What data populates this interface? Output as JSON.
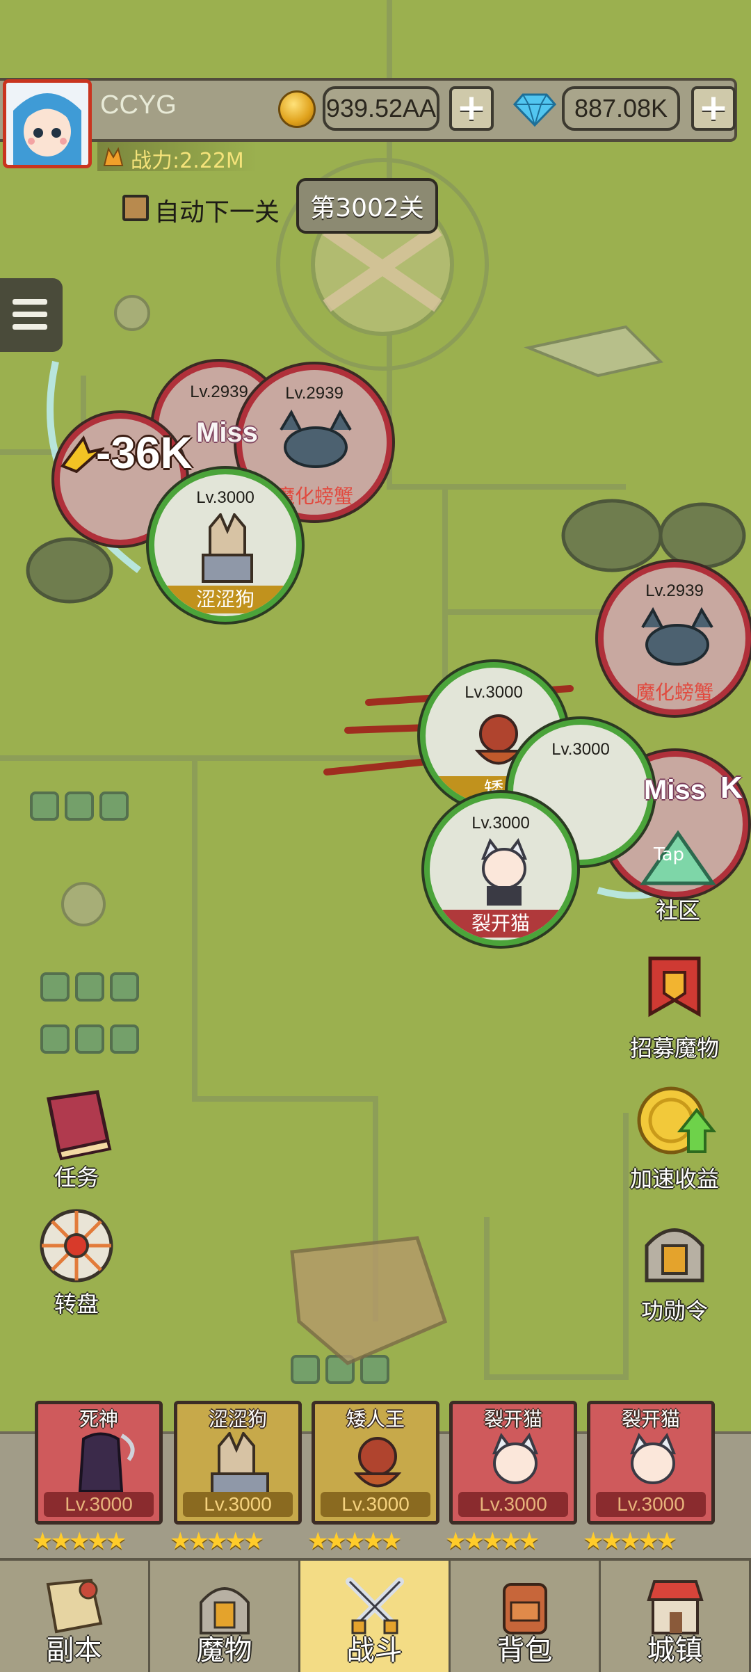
{
  "player": {
    "name": "CCYG",
    "power": "战力:2.22M"
  },
  "resources": {
    "gold": "939.52AA",
    "gems": "887.08K",
    "plus": "+"
  },
  "stage": {
    "auto_next_label": "自动下一关",
    "stage_label": "第3002关"
  },
  "battle": {
    "enemies": [
      {
        "lv": "Lv.2939",
        "name": ""
      },
      {
        "lv": "Lv.2939",
        "name": "魔化螃蟹"
      },
      {
        "lv": "Lv.2939",
        "name": "魔化螃蟹"
      },
      {
        "lv": "Lv.2939",
        "name": ""
      }
    ],
    "allies": [
      {
        "lv": "Lv.3000",
        "name": "涩涩狗"
      },
      {
        "lv": "Lv.3000",
        "name": "矮"
      },
      {
        "lv": "Lv.3000",
        "name": ""
      },
      {
        "lv": "Lv.3000",
        "name": "裂开猫"
      }
    ],
    "damage_text": "-36K",
    "miss_text_1": "Miss",
    "miss_text_2": "Miss",
    "partial_dmg": "K"
  },
  "side_buttons": {
    "community": "社区",
    "community_tap": "Tap",
    "recruit": "招募魔物",
    "boost": "加速收益",
    "merit": "功勋令",
    "quest": "任务",
    "wheel": "转盘"
  },
  "heroes": [
    {
      "name": "死神",
      "lv": "Lv.3000",
      "stars": "★★★★★"
    },
    {
      "name": "涩涩狗",
      "lv": "Lv.3000",
      "stars": "★★★★★"
    },
    {
      "name": "矮人王",
      "lv": "Lv.3000",
      "stars": "★★★★★"
    },
    {
      "name": "裂开猫",
      "lv": "Lv.3000",
      "stars": "★★★★★"
    },
    {
      "name": "裂开猫",
      "lv": "Lv.3000",
      "stars": "★★★★★"
    }
  ],
  "nav": [
    {
      "label": "副本"
    },
    {
      "label": "魔物"
    },
    {
      "label": "战斗"
    },
    {
      "label": "背包"
    },
    {
      "label": "城镇"
    }
  ]
}
